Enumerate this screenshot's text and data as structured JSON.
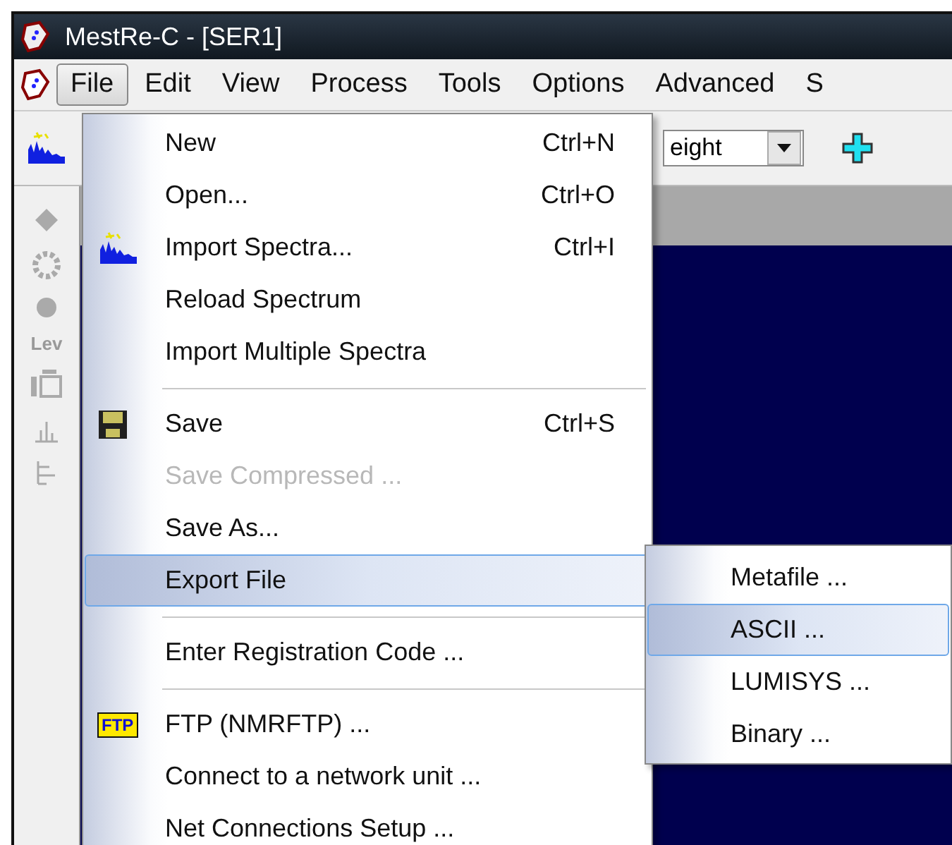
{
  "window": {
    "title": "MestRe-C - [SER1]"
  },
  "menu_bar": [
    {
      "label": "File",
      "selected": true
    },
    {
      "label": "Edit",
      "selected": false
    },
    {
      "label": "View",
      "selected": false
    },
    {
      "label": "Process",
      "selected": false
    },
    {
      "label": "Tools",
      "selected": false
    },
    {
      "label": "Options",
      "selected": false
    },
    {
      "label": "Advanced",
      "selected": false
    },
    {
      "label": "S",
      "selected": false
    }
  ],
  "toolbar": {
    "combo_value": "eight"
  },
  "left_toolbar": {
    "label": "Lev"
  },
  "file_menu": [
    {
      "kind": "item",
      "label": "New",
      "shortcut": "Ctrl+N",
      "disabled": false,
      "selected": false
    },
    {
      "kind": "item",
      "label": "Open...",
      "shortcut": "Ctrl+O",
      "disabled": false,
      "selected": false
    },
    {
      "kind": "spectrum",
      "label": "Import Spectra...",
      "shortcut": "Ctrl+I",
      "disabled": false,
      "selected": false
    },
    {
      "kind": "item",
      "label": "Reload Spectrum",
      "disabled": false,
      "selected": false
    },
    {
      "kind": "item",
      "label": "Import Multiple Spectra",
      "disabled": false,
      "selected": false
    },
    {
      "kind": "separator"
    },
    {
      "kind": "floppy",
      "label": "Save",
      "shortcut": "Ctrl+S",
      "disabled": false,
      "selected": false
    },
    {
      "kind": "item",
      "label": "Save Compressed ...",
      "disabled": true,
      "selected": false
    },
    {
      "kind": "item",
      "label": "Save As...",
      "disabled": false,
      "selected": false
    },
    {
      "kind": "item",
      "label": "Export File",
      "disabled": false,
      "selected": true
    },
    {
      "kind": "separator"
    },
    {
      "kind": "item",
      "label": "Enter Registration Code ...",
      "disabled": false,
      "selected": false
    },
    {
      "kind": "separator"
    },
    {
      "kind": "badge",
      "badge_text": "FTP",
      "label": "FTP (NMRFTP) ...",
      "disabled": false,
      "selected": false
    },
    {
      "kind": "item",
      "label": "Connect to a network unit ...",
      "disabled": false,
      "selected": false
    },
    {
      "kind": "item",
      "label": "Net Connections Setup ...",
      "disabled": false,
      "selected": false
    }
  ],
  "export_submenu": [
    {
      "label": "Metafile ...",
      "selected": false
    },
    {
      "label": "ASCII ...",
      "selected": true
    },
    {
      "label": "LUMISYS ...",
      "selected": false
    },
    {
      "label": "Binary ...",
      "selected": false
    }
  ]
}
